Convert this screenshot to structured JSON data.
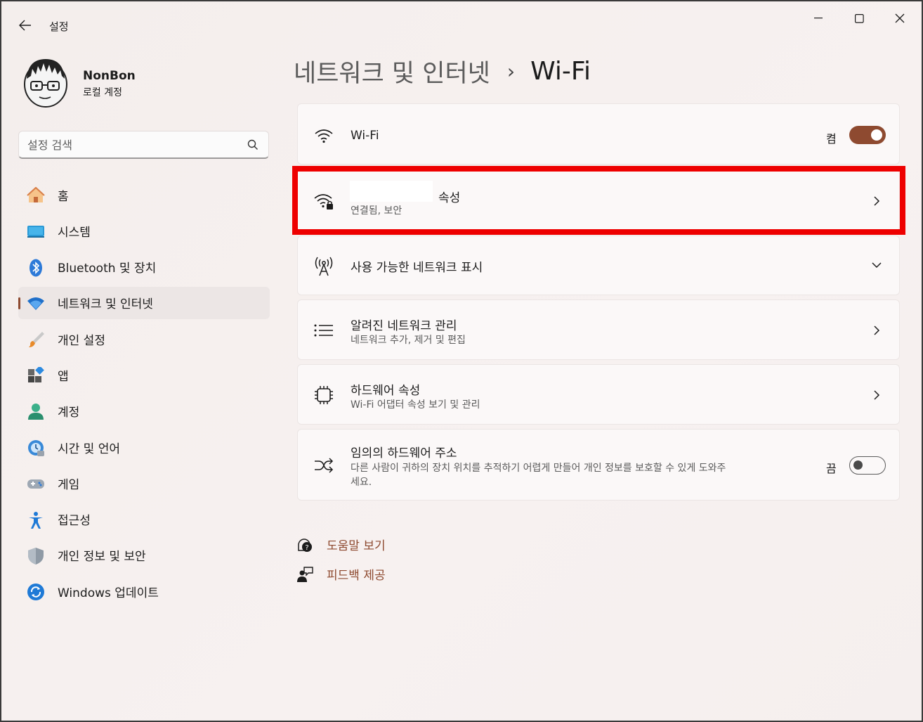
{
  "app": {
    "title": "설정"
  },
  "profile": {
    "name": "NonBon",
    "account_type": "로컬 계정"
  },
  "search": {
    "placeholder": "설정 검색"
  },
  "sidebar": {
    "items": [
      {
        "label": "홈",
        "icon": "home-icon"
      },
      {
        "label": "시스템",
        "icon": "system-icon"
      },
      {
        "label": "Bluetooth 및 장치",
        "icon": "bluetooth-icon"
      },
      {
        "label": "네트워크 및 인터넷",
        "icon": "network-icon",
        "active": true
      },
      {
        "label": "개인 설정",
        "icon": "personalization-brush-icon"
      },
      {
        "label": "앱",
        "icon": "apps-icon"
      },
      {
        "label": "계정",
        "icon": "accounts-icon"
      },
      {
        "label": "시간 및 언어",
        "icon": "time-language-icon"
      },
      {
        "label": "게임",
        "icon": "gaming-icon"
      },
      {
        "label": "접근성",
        "icon": "accessibility-icon"
      },
      {
        "label": "개인 정보 및 보안",
        "icon": "privacy-shield-icon"
      },
      {
        "label": "Windows 업데이트",
        "icon": "windows-update-icon"
      }
    ]
  },
  "breadcrumb": {
    "parent": "네트워크 및 인터넷",
    "separator": "›",
    "current": "Wi-Fi"
  },
  "main": {
    "wifi": {
      "title": "Wi-Fi",
      "state": "켬",
      "on": true
    },
    "connected": {
      "title_suffix": "속성",
      "subtitle": "연결됨, 보안"
    },
    "available": {
      "title": "사용 가능한 네트워크 표시"
    },
    "known": {
      "title": "알려진 네트워크 관리",
      "subtitle": "네트워크 추가, 제거 및 편집"
    },
    "hardware": {
      "title": "하드웨어 속성",
      "subtitle": "Wi-Fi 어댑터 속성 보기 및 관리"
    },
    "random_mac": {
      "title": "임의의 하드웨어 주소",
      "subtitle_line1": "다른 사람이 귀하의 장치 위치를 추적하기 어렵게 만들어 개인 정보를 보호할 수 있게 도와주",
      "subtitle_line2": "세요.",
      "state": "끔",
      "on": false
    }
  },
  "footer": {
    "help": "도움말 보기",
    "feedback": "피드백 제공"
  },
  "colors": {
    "accent": "#8e4a30",
    "highlight": "#ee0000"
  }
}
